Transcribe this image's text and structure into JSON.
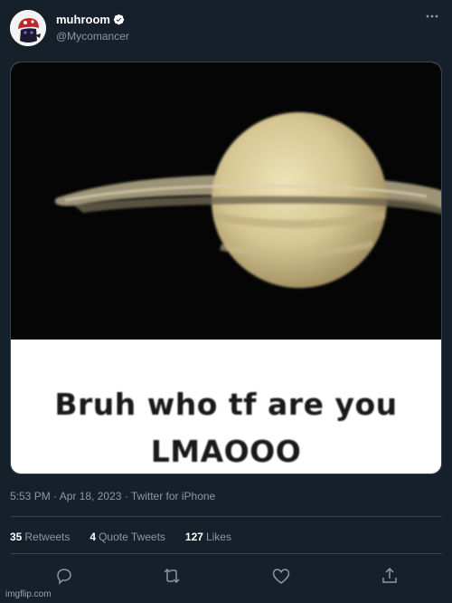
{
  "user": {
    "display_name": "muhroom",
    "handle": "@Mycomancer",
    "avatar_icon": "mushroom-character-avatar",
    "verified_icon": "verified-badge-icon"
  },
  "tweet": {
    "image": {
      "description_icon": "saturn-meme-image",
      "caption_line1": "Bruh who tf are you",
      "caption_line2": "LMAOOO"
    },
    "timestamp": "5:53 PM · Apr 18, 2023 · Twitter for iPhone"
  },
  "stats": {
    "retweets_count": "35",
    "retweets_label": "Retweets",
    "quotes_count": "4",
    "quotes_label": "Quote Tweets",
    "likes_count": "127",
    "likes_label": "Likes"
  },
  "actions": {
    "reply_icon": "reply-icon",
    "retweet_icon": "retweet-icon",
    "like_icon": "heart-icon",
    "share_icon": "share-icon"
  },
  "watermark": "imgflip.com",
  "colors": {
    "background": "#15202b",
    "secondary_text": "#8b98a5",
    "divider": "#38444d"
  }
}
